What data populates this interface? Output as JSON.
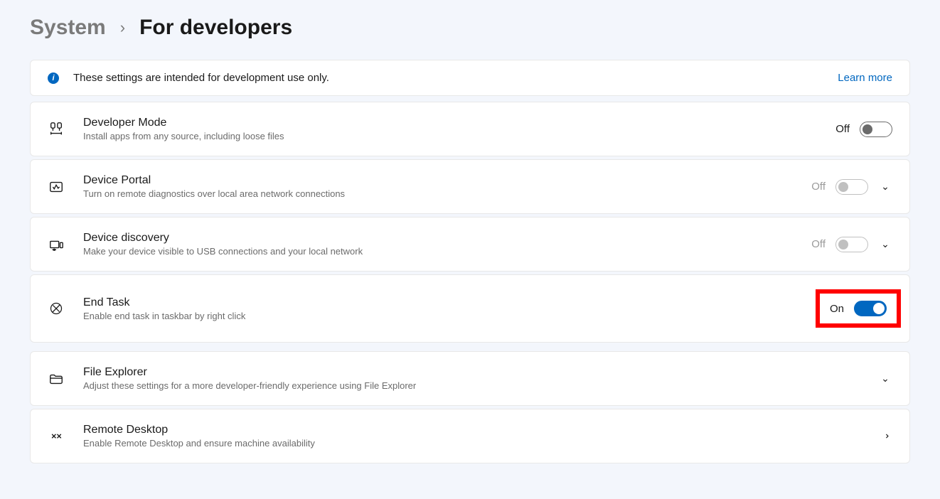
{
  "breadcrumb": {
    "system": "System",
    "page": "For developers"
  },
  "infoBanner": {
    "text": "These settings are intended for development use only.",
    "link": "Learn more"
  },
  "settings": {
    "devMode": {
      "title": "Developer Mode",
      "subtitle": "Install apps from any source, including loose files",
      "state": "Off"
    },
    "devicePortal": {
      "title": "Device Portal",
      "subtitle": "Turn on remote diagnostics over local area network connections",
      "state": "Off"
    },
    "deviceDiscovery": {
      "title": "Device discovery",
      "subtitle": "Make your device visible to USB connections and your local network",
      "state": "Off"
    },
    "endTask": {
      "title": "End Task",
      "subtitle": "Enable end task in taskbar by right click",
      "state": "On"
    },
    "fileExplorer": {
      "title": "File Explorer",
      "subtitle": "Adjust these settings for a more developer-friendly experience using File Explorer"
    },
    "remoteDesktop": {
      "title": "Remote Desktop",
      "subtitle": "Enable Remote Desktop and ensure machine availability"
    }
  }
}
